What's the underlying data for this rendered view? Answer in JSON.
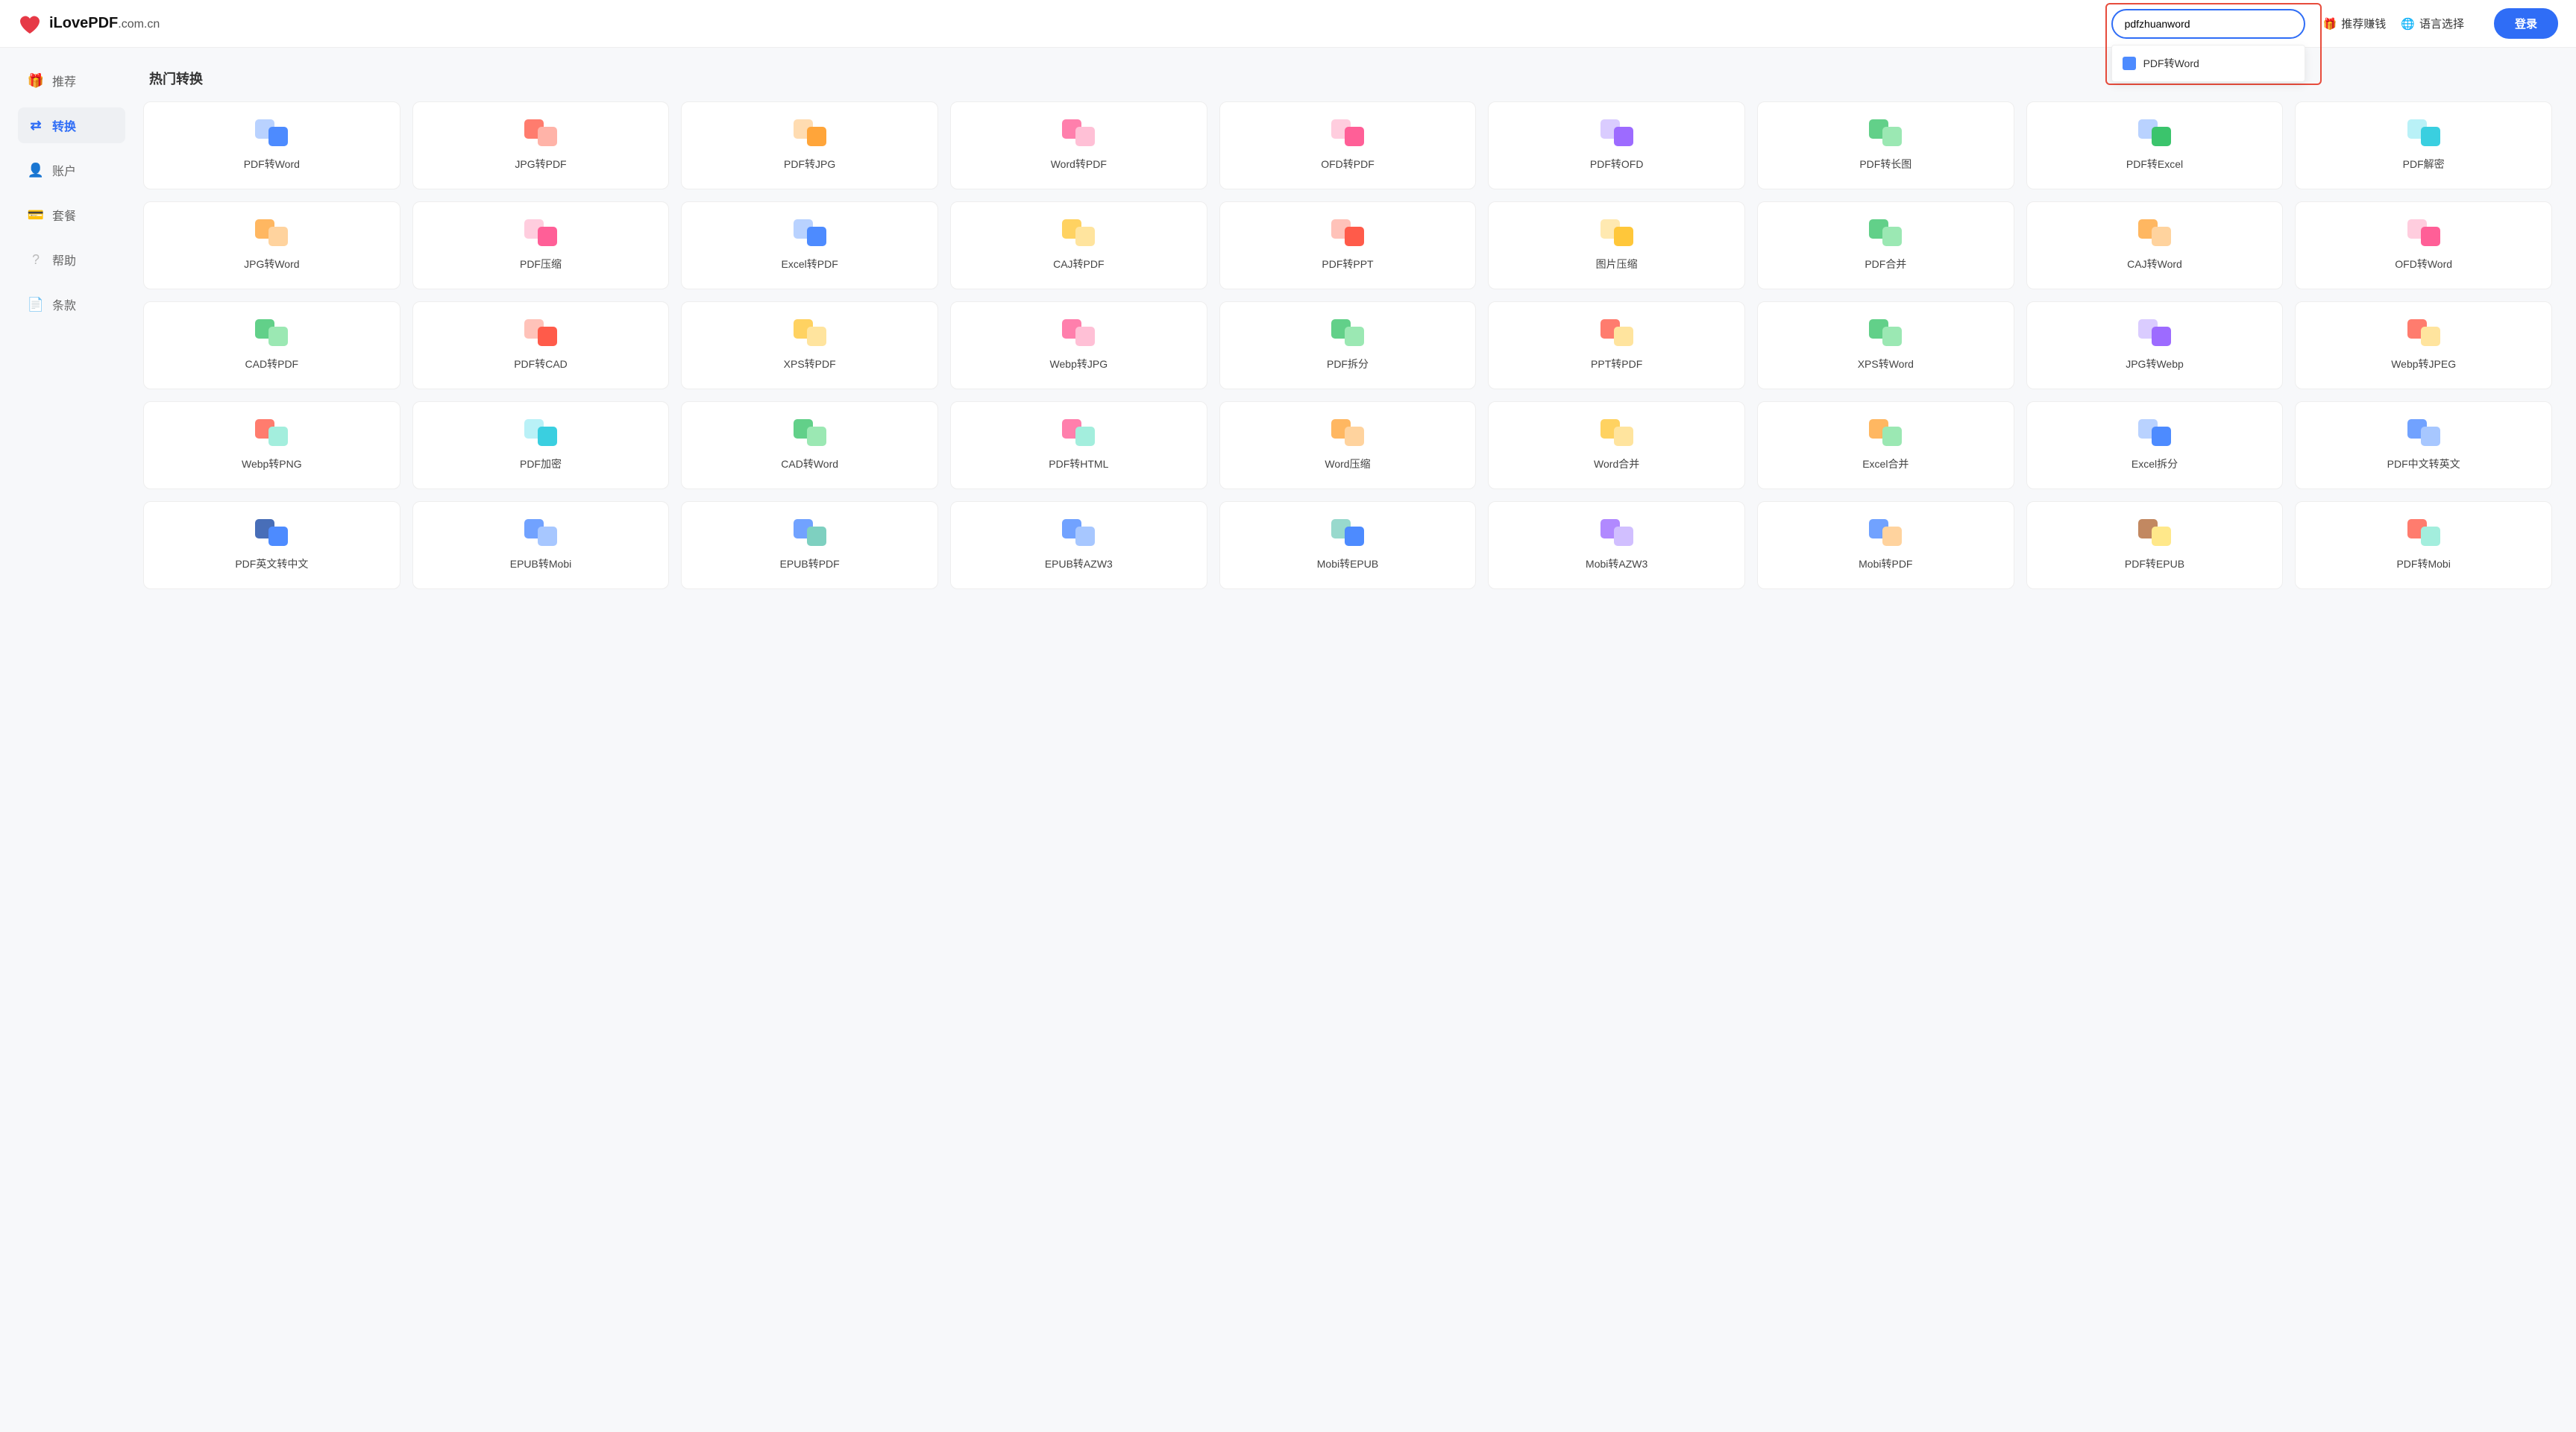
{
  "brand": {
    "name": "iLovePDF",
    "suffix": ".com.cn"
  },
  "header": {
    "search_value": "pdfzhuanword",
    "search_placeholder": "",
    "suggestion": "PDF转Word",
    "referral": "推荐赚钱",
    "language": "语言选择",
    "login": "登录"
  },
  "sidebar": {
    "items": [
      {
        "icon": "gift-icon",
        "label": "推荐"
      },
      {
        "icon": "convert-icon",
        "label": "转换"
      },
      {
        "icon": "user-icon",
        "label": "账户"
      },
      {
        "icon": "card-icon",
        "label": "套餐"
      },
      {
        "icon": "help-icon",
        "label": "帮助"
      },
      {
        "icon": "terms-icon",
        "label": "条款"
      }
    ],
    "active_index": 1
  },
  "section_title": "热门转换",
  "tools": [
    {
      "label": "PDF转Word",
      "c1": "c-lblue",
      "c2": "c-blue"
    },
    {
      "label": "JPG转PDF",
      "c1": "c-red",
      "c2": "c-lred"
    },
    {
      "label": "PDF转JPG",
      "c1": "c-lorange",
      "c2": "c-orange"
    },
    {
      "label": "Word转PDF",
      "c1": "c-pink",
      "c2": "c-lpink"
    },
    {
      "label": "OFD转PDF",
      "c1": "c-lpink",
      "c2": "c-pink"
    },
    {
      "label": "PDF转OFD",
      "c1": "c-lviolet",
      "c2": "c-violet"
    },
    {
      "label": "PDF转长图",
      "c1": "c-green",
      "c2": "c-lgreen"
    },
    {
      "label": "PDF转Excel",
      "c1": "c-lblue",
      "c2": "c-green"
    },
    {
      "label": "PDF解密",
      "c1": "c-lcyan",
      "c2": "c-cyan"
    },
    {
      "label": "JPG转Word",
      "c1": "c-orange",
      "c2": "c-lorange"
    },
    {
      "label": "PDF压缩",
      "c1": "c-lpink",
      "c2": "c-pink"
    },
    {
      "label": "Excel转PDF",
      "c1": "c-lblue",
      "c2": "c-blue"
    },
    {
      "label": "CAJ转PDF",
      "c1": "c-yellow",
      "c2": "c-lyellow"
    },
    {
      "label": "PDF转PPT",
      "c1": "c-lred",
      "c2": "c-red"
    },
    {
      "label": "图片压缩",
      "c1": "c-lyellow",
      "c2": "c-yellow"
    },
    {
      "label": "PDF合并",
      "c1": "c-green",
      "c2": "c-lgreen"
    },
    {
      "label": "CAJ转Word",
      "c1": "c-orange",
      "c2": "c-lorange"
    },
    {
      "label": "OFD转Word",
      "c1": "c-lpink",
      "c2": "c-pink"
    },
    {
      "label": "CAD转PDF",
      "c1": "c-green",
      "c2": "c-lgreen"
    },
    {
      "label": "PDF转CAD",
      "c1": "c-lred",
      "c2": "c-red"
    },
    {
      "label": "XPS转PDF",
      "c1": "c-yellow",
      "c2": "c-lyellow"
    },
    {
      "label": "Webp转JPG",
      "c1": "c-pink",
      "c2": "c-lpink"
    },
    {
      "label": "PDF拆分",
      "c1": "c-green",
      "c2": "c-lgreen"
    },
    {
      "label": "PPT转PDF",
      "c1": "c-red",
      "c2": "c-lyellow"
    },
    {
      "label": "XPS转Word",
      "c1": "c-green",
      "c2": "c-lgreen"
    },
    {
      "label": "JPG转Webp",
      "c1": "c-lviolet",
      "c2": "c-violet"
    },
    {
      "label": "Webp转JPEG",
      "c1": "c-red",
      "c2": "c-lyellow"
    },
    {
      "label": "Webp转PNG",
      "c1": "c-red",
      "c2": "c-lteal"
    },
    {
      "label": "PDF加密",
      "c1": "c-lcyan",
      "c2": "c-cyan"
    },
    {
      "label": "CAD转Word",
      "c1": "c-green",
      "c2": "c-lgreen"
    },
    {
      "label": "PDF转HTML",
      "c1": "c-pink",
      "c2": "c-lteal"
    },
    {
      "label": "Word压缩",
      "c1": "c-orange",
      "c2": "c-lorange"
    },
    {
      "label": "Word合并",
      "c1": "c-yellow",
      "c2": "c-lyellow"
    },
    {
      "label": "Excel合并",
      "c1": "c-orange",
      "c2": "c-lgreen"
    },
    {
      "label": "Excel拆分",
      "c1": "c-lblue",
      "c2": "c-blue"
    },
    {
      "label": "PDF中文转英文",
      "c1": "c-blue",
      "c2": "c-lblue"
    },
    {
      "label": "PDF英文转中文",
      "c1": "c-navy",
      "c2": "c-blue"
    },
    {
      "label": "EPUB转Mobi",
      "c1": "c-blue",
      "c2": "c-lblue"
    },
    {
      "label": "EPUB转PDF",
      "c1": "c-blue",
      "c2": "c-lteal2"
    },
    {
      "label": "EPUB转AZW3",
      "c1": "c-blue",
      "c2": "c-lblue"
    },
    {
      "label": "Mobi转EPUB",
      "c1": "c-lteal2",
      "c2": "c-blue"
    },
    {
      "label": "Mobi转AZW3",
      "c1": "c-violet",
      "c2": "c-lviolet"
    },
    {
      "label": "Mobi转PDF",
      "c1": "c-blue",
      "c2": "c-lorange"
    },
    {
      "label": "PDF转EPUB",
      "c1": "c-brown",
      "c2": "c-lyellow2"
    },
    {
      "label": "PDF转Mobi",
      "c1": "c-red",
      "c2": "c-lteal"
    }
  ]
}
